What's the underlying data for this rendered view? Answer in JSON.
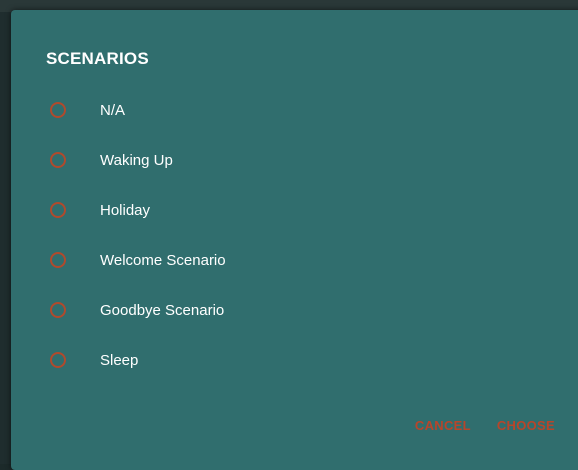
{
  "dialog": {
    "title": "SCENARIOS",
    "options": [
      {
        "label": "N/A"
      },
      {
        "label": "Waking Up"
      },
      {
        "label": "Holiday"
      },
      {
        "label": "Welcome Scenario"
      },
      {
        "label": "Goodbye Scenario"
      },
      {
        "label": "Sleep"
      }
    ],
    "cancel_label": "CANCEL",
    "choose_label": "CHOOSE"
  },
  "colors": {
    "dialog_bg": "#306e6e",
    "accent": "#b8452a",
    "text": "#ffffff"
  },
  "icons": {
    "radio": "radio-unchecked-icon"
  }
}
